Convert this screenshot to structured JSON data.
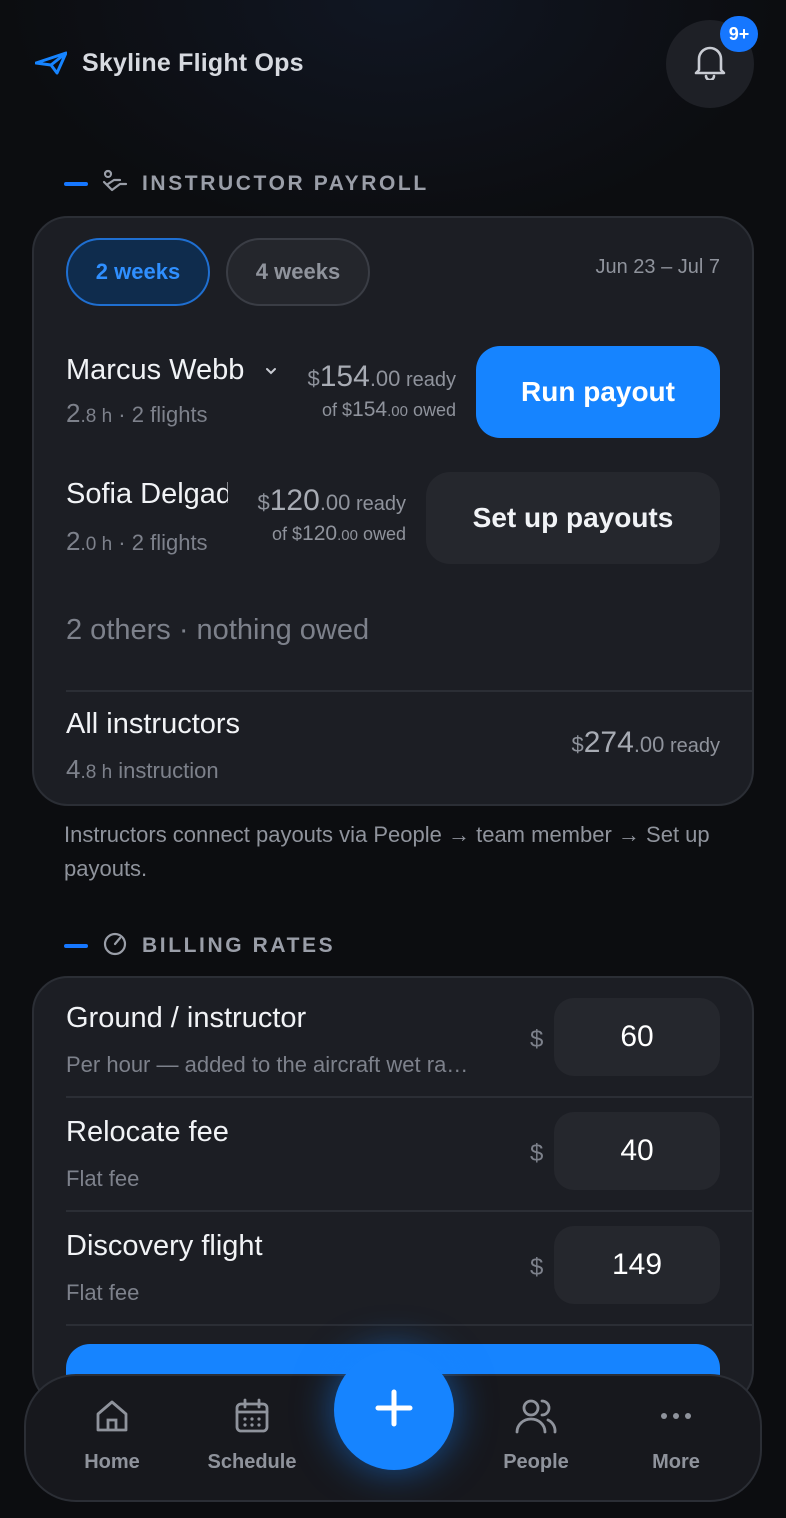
{
  "app": {
    "title": "Skyline Flight Ops",
    "notifications_badge": "9+",
    "accent": "#1684ff"
  },
  "payroll": {
    "section_title": "INSTRUCTOR PAYROLL",
    "periods": [
      {
        "label": "2 weeks",
        "active": true
      },
      {
        "label": "4 weeks",
        "active": false
      }
    ],
    "date_range": "Jun 23 – Jul 7",
    "instructors": [
      {
        "name": "Marcus Webb",
        "hours_whole": "2",
        "hours_dec": ".8 h",
        "flights": "· 2 flights",
        "ready_cur": "$",
        "ready_whole": "154",
        "ready_dec": ".00",
        "ready_label": " ready",
        "owed_prefix": "of $",
        "owed_whole": "154",
        "owed_dec": ".00",
        "owed_label": " owed",
        "action": "Run payout"
      },
      {
        "name": "Sofia Delgado",
        "hours_whole": "2",
        "hours_dec": ".0 h",
        "flights": "· 2 flights",
        "ready_cur": "$",
        "ready_whole": "120",
        "ready_dec": ".00",
        "ready_label": " ready",
        "owed_prefix": "of $",
        "owed_whole": "120",
        "owed_dec": ".00",
        "owed_label": " owed",
        "action": "Set up payouts"
      }
    ],
    "others": "2 others · nothing owed",
    "total": {
      "label": "All instructors",
      "hours_whole": "4",
      "hours_dec": ".8 h",
      "hours_label": " instruction",
      "cur": "$",
      "whole": "274",
      "dec": ".00",
      "ready_label": " ready"
    },
    "note": "Instructors connect payouts via People → team member → Set up payouts."
  },
  "billing": {
    "section_title": "BILLING RATES",
    "currency": "$",
    "rates": [
      {
        "name": "Ground / instructor",
        "desc": "Per hour — added to the aircraft wet ra…",
        "value": "60"
      },
      {
        "name": "Relocate fee",
        "desc": "Flat fee",
        "value": "40"
      },
      {
        "name": "Discovery flight",
        "desc": "Flat fee",
        "value": "149"
      }
    ]
  },
  "nav": {
    "items": [
      {
        "label": "Home"
      },
      {
        "label": "Schedule"
      },
      {
        "label": "People"
      },
      {
        "label": "More"
      }
    ]
  }
}
